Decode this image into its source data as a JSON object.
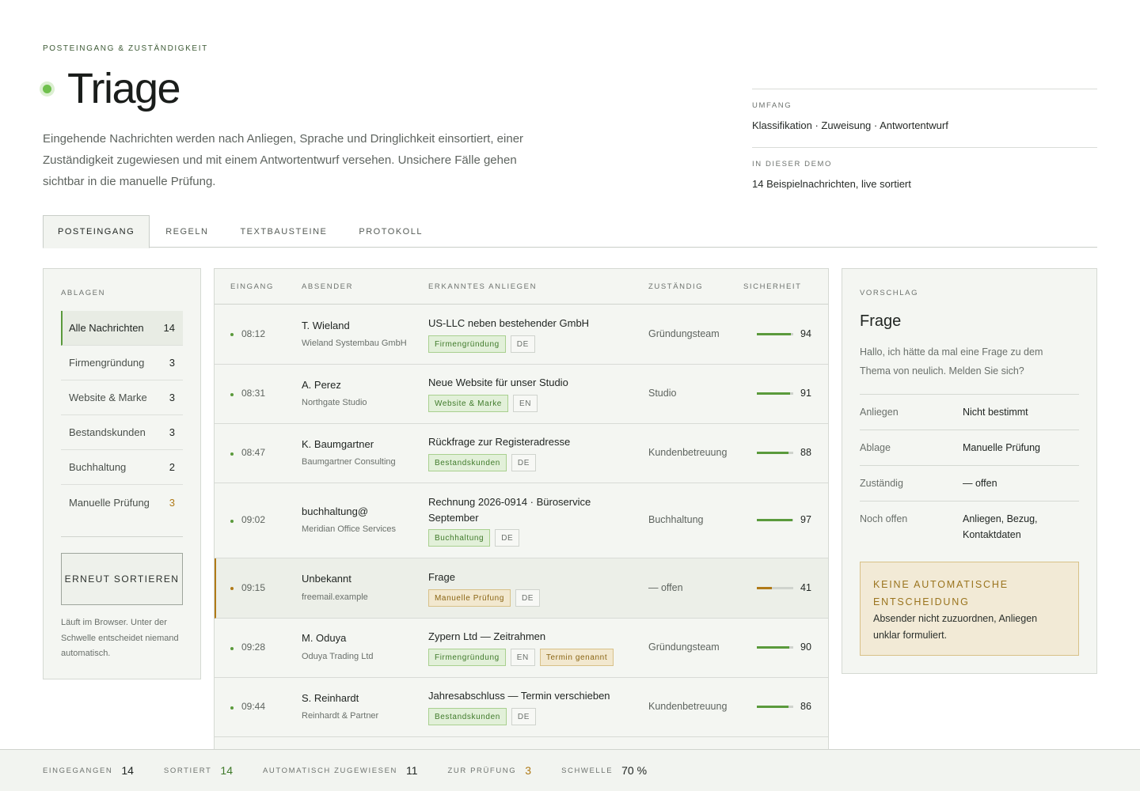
{
  "header": {
    "eyebrow": "POSTEINGANG & ZUSTÄNDIGKEIT",
    "title": "Triage",
    "intro": "Eingehende Nachrichten werden nach Anliegen, Sprache und Dringlichkeit einsortiert, einer Zuständigkeit zugewiesen und mit einem Antwortentwurf versehen. Unsichere Fälle gehen sichtbar in die manuelle Prüfung."
  },
  "meta": [
    {
      "label": "UMFANG",
      "value": "Klassifikation · Zuweisung · Antwortentwurf"
    },
    {
      "label": "IN DIESER DEMO",
      "value": "14 Beispielnachrichten, live sortiert"
    }
  ],
  "tabs": [
    {
      "label": "POSTEINGANG",
      "active": true
    },
    {
      "label": "REGELN",
      "active": false
    },
    {
      "label": "TEXTBAUSTEINE",
      "active": false
    },
    {
      "label": "PROTOKOLL",
      "active": false
    }
  ],
  "sidebar": {
    "label": "ABLAGEN",
    "items": [
      {
        "label": "Alle Nachrichten",
        "count": "14"
      },
      {
        "label": "Firmengründung",
        "count": "3"
      },
      {
        "label": "Website & Marke",
        "count": "3"
      },
      {
        "label": "Bestandskunden",
        "count": "3"
      },
      {
        "label": "Buchhaltung",
        "count": "2"
      },
      {
        "label": "Manuelle Prüfung",
        "count": "3"
      }
    ],
    "resort_label": "ERNEUT SORTIEREN",
    "note": "Läuft im Browser. Unter der Schwelle entscheidet niemand automatisch."
  },
  "table": {
    "columns": [
      "EINGANG",
      "ABSENDER",
      "ERKANNTES ANLIEGEN",
      "ZUSTÄNDIG",
      "SICHERHEIT"
    ],
    "rows": [
      {
        "time": "08:12",
        "sender": "T. Wieland",
        "org": "Wieland Systembau GmbH",
        "subject": "US-LLC neben bestehender GmbH",
        "tags": [
          "Firmengründung",
          "DE"
        ],
        "owner": "Gründungsteam",
        "score": "94",
        "confidence": 0.94
      },
      {
        "time": "08:31",
        "sender": "A. Perez",
        "org": "Northgate Studio",
        "subject": "Neue Website für unser Studio",
        "tags": [
          "Website & Marke",
          "EN"
        ],
        "owner": "Studio",
        "score": "91",
        "confidence": 0.91
      },
      {
        "time": "08:47",
        "sender": "K. Baumgartner",
        "org": "Baumgartner Consulting",
        "subject": "Rückfrage zur Registeradresse",
        "tags": [
          "Bestandskunden",
          "DE"
        ],
        "owner": "Kundenbetreuung",
        "score": "88",
        "confidence": 0.88
      },
      {
        "time": "09:02",
        "sender": "buchhaltung@",
        "org": "Meridian Office Services",
        "subject": "Rechnung 2026-0914 · Büroservice September",
        "tags": [
          "Buchhaltung",
          "DE"
        ],
        "owner": "Buchhaltung",
        "score": "97",
        "confidence": 0.97
      },
      {
        "time": "09:15",
        "sender": "Unbekannt",
        "org": "freemail.example",
        "subject": "Frage",
        "tags": [
          "Manuelle Prüfung",
          "DE"
        ],
        "owner": "— offen",
        "score": "41",
        "confidence": 0.41
      },
      {
        "time": "09:28",
        "sender": "M. Oduya",
        "org": "Oduya Trading Ltd",
        "subject": "Zypern Ltd — Zeitrahmen",
        "tags": [
          "Firmengründung",
          "EN",
          "Termin genannt"
        ],
        "owner": "Gründungsteam",
        "score": "90",
        "confidence": 0.9
      },
      {
        "time": "09:44",
        "sender": "S. Reinhardt",
        "org": "Reinhardt & Partner",
        "subject": "Jahresabschluss — Termin verschieben",
        "tags": [
          "Bestandskunden",
          "DE"
        ],
        "owner": "Kundenbetreuung",
        "score": "86",
        "confidence": 0.86
      }
    ]
  },
  "panel": {
    "label": "VORSCHLAG",
    "title": "Frage",
    "text": "Hallo, ich hätte da mal eine Frage zu dem Thema von neulich. Melden Sie sich?",
    "rows": [
      {
        "key": "Anliegen",
        "value": "Nicht bestimmt"
      },
      {
        "key": "Ablage",
        "value": "Manuelle Prüfung"
      },
      {
        "key": "Zuständig",
        "value": "— offen"
      },
      {
        "key": "Noch offen",
        "value": "Anliegen, Bezug, Kontaktdaten"
      }
    ],
    "warning_title": "KEINE AUTOMATISCHE ENTSCHEIDUNG",
    "warning_text": "Absender nicht zuzuordnen, Anliegen unklar formuliert."
  },
  "footer": [
    {
      "label": "EINGEGANGEN",
      "value": "14",
      "tone": ""
    },
    {
      "label": "SORTIERT",
      "value": "14",
      "tone": "green"
    },
    {
      "label": "AUTOMATISCH ZUGEWIESEN",
      "value": "11",
      "tone": ""
    },
    {
      "label": "ZUR PRÜFUNG",
      "value": "3",
      "tone": "amber"
    },
    {
      "label": "SCHWELLE",
      "value": "70 %",
      "tone": ""
    }
  ],
  "colors": {
    "accent": "#5a9a3c",
    "warning": "#b07a18",
    "background": "#f4f6f2"
  }
}
